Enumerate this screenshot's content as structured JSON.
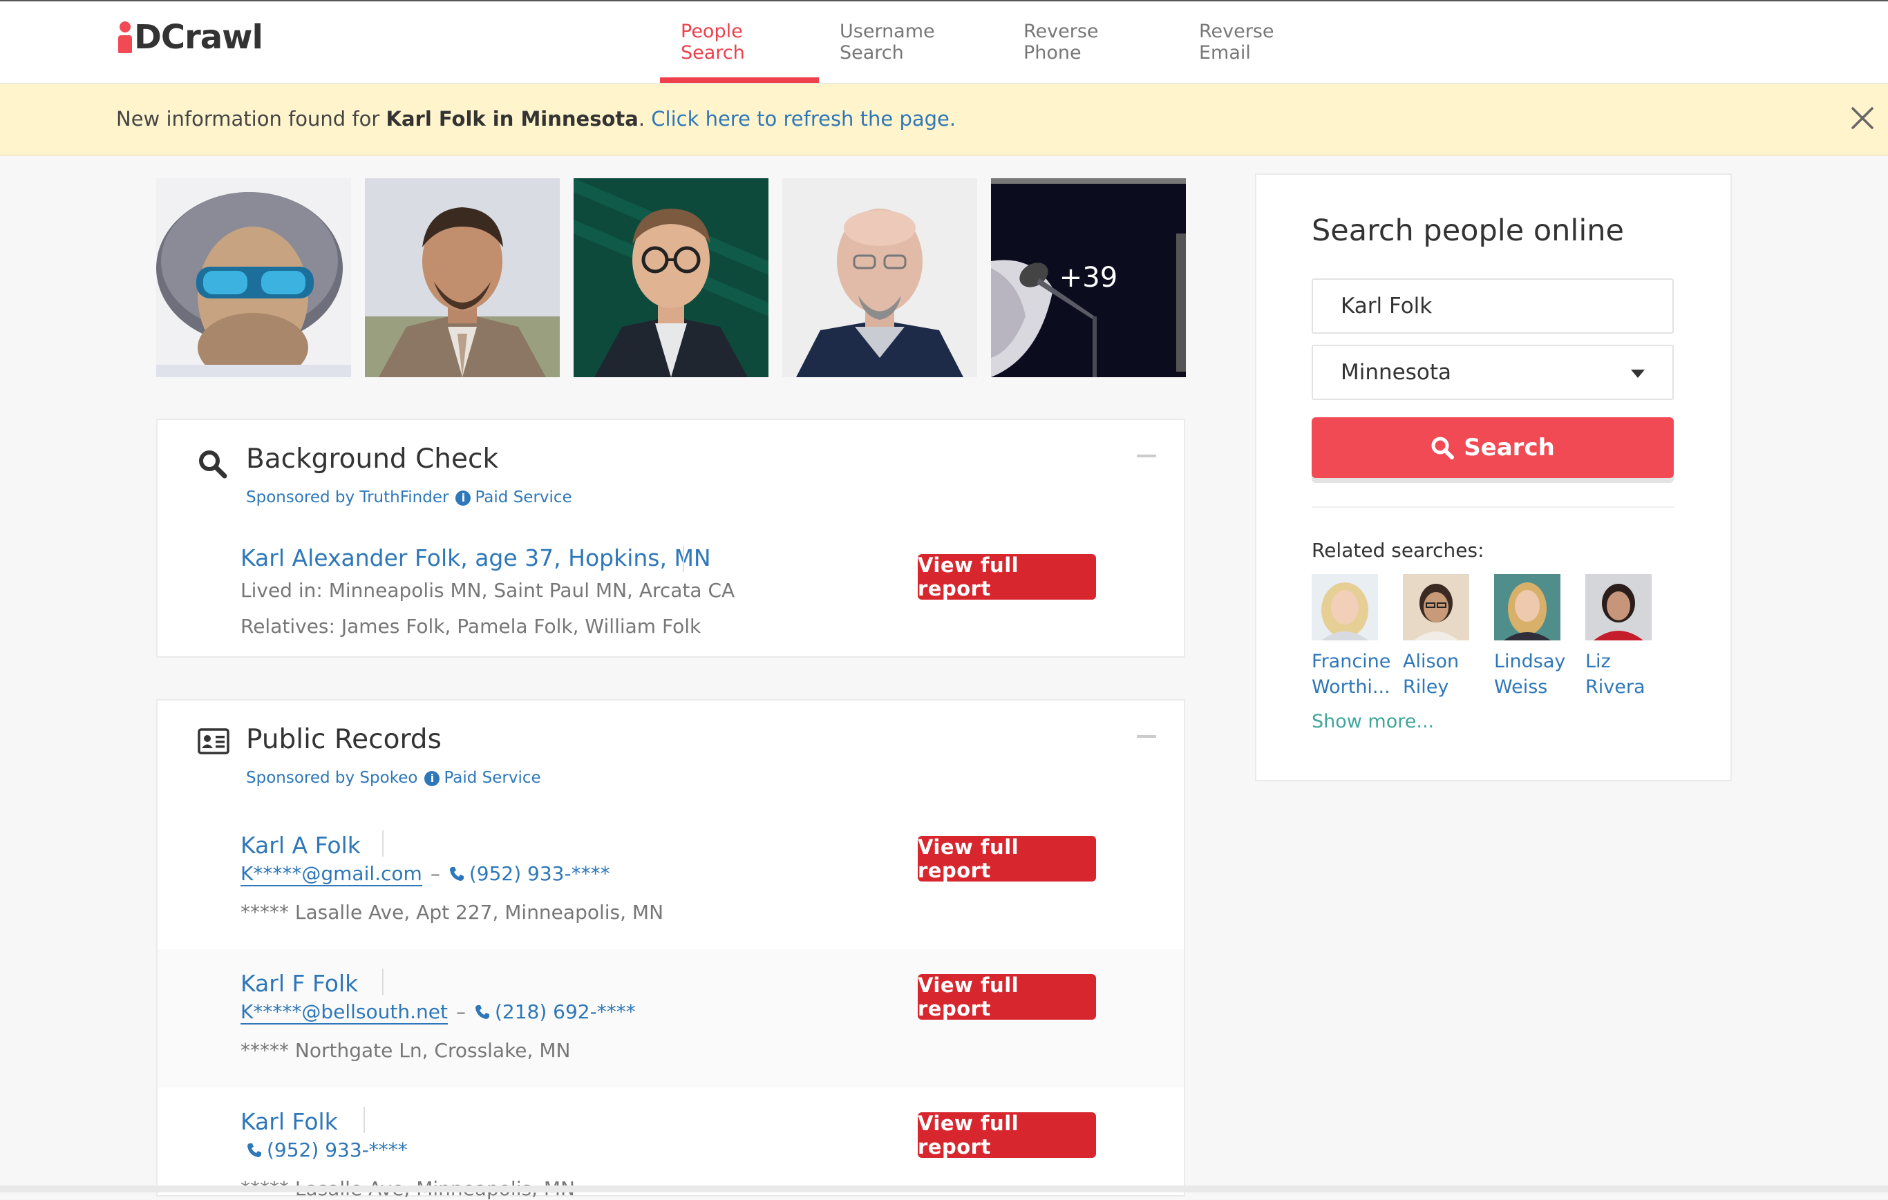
{
  "brand": {
    "logo_text": "DCrawl",
    "accent": "#f24a54",
    "link_color": "#2e77b8",
    "button_color": "#d7262d"
  },
  "nav": {
    "tabs": [
      {
        "label": "People Search",
        "active": true
      },
      {
        "label": "Username Search",
        "active": false
      },
      {
        "label": "Reverse Phone",
        "active": false
      },
      {
        "label": "Reverse Email",
        "active": false
      }
    ]
  },
  "banner": {
    "prefix": "New information found for ",
    "highlight": "Karl Folk in Minnesota",
    "suffix": ". ",
    "link": "Click here to refresh the page.",
    "close_icon": "close-icon"
  },
  "photos": {
    "more_count": "+39"
  },
  "background_check": {
    "title": "Background Check",
    "sponsor": "Sponsored by TruthFinder",
    "paid": "Paid Service",
    "results": [
      {
        "name": "Karl Alexander Folk, age 37, Hopkins, MN",
        "lived_in": "Lived in: Minneapolis MN, Saint Paul MN, Arcata CA",
        "relatives": "Relatives: James Folk, Pamela Folk, William Folk",
        "button": "View full report"
      }
    ]
  },
  "public_records": {
    "title": "Public Records",
    "sponsor": "Sponsored by Spokeo",
    "paid": "Paid Service",
    "results": [
      {
        "name": "Karl A Folk",
        "email": "K*****@gmail.com",
        "phone": "(952) 933-****",
        "address": "***** Lasalle Ave, Apt 227, Minneapolis, MN",
        "button": "View full report"
      },
      {
        "name": "Karl F Folk",
        "email": "K*****@bellsouth.net",
        "phone": "(218) 692-****",
        "address": "***** Northgate Ln, Crosslake, MN",
        "button": "View full report"
      },
      {
        "name": "Karl Folk",
        "phone": "(952) 933-****",
        "address": "***** Lasalle Ave, Minneapolis, MN",
        "button": "View full report"
      }
    ]
  },
  "sidebar": {
    "title": "Search people online",
    "name_value": "Karl Folk",
    "state_value": "Minnesota",
    "search_button": "Search",
    "related_label": "Related searches:",
    "related": [
      {
        "name": "Francine\nWorthi..."
      },
      {
        "name": "Alison\nRiley"
      },
      {
        "name": "Lindsay\nWeiss"
      },
      {
        "name": "Liz\nRivera"
      }
    ],
    "show_more": "Show more..."
  }
}
